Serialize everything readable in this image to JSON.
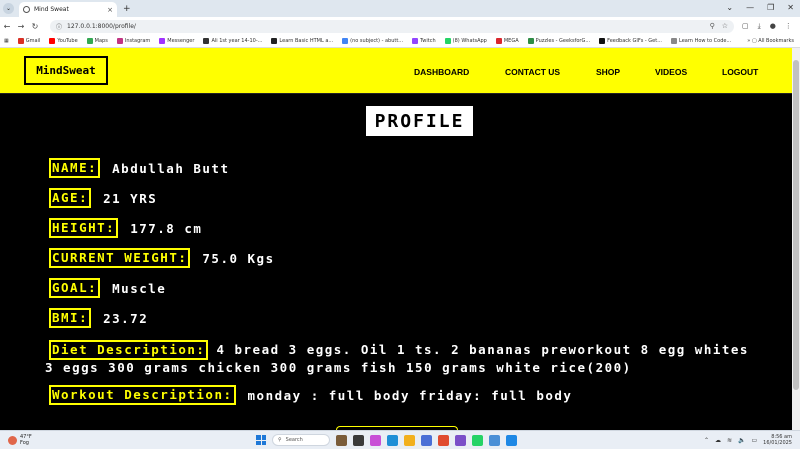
{
  "browser": {
    "tab_title": "Mind Sweat",
    "tab_close": "×",
    "new_tab": "+",
    "url": "127.0.0.1:8000/profile/",
    "window_controls": [
      "⌄",
      "—",
      "❐",
      "✕"
    ],
    "bookmarks": [
      {
        "label": "Gmail",
        "color": "#d93025"
      },
      {
        "label": "YouTube",
        "color": "#ff0000"
      },
      {
        "label": "Maps",
        "color": "#34a853"
      },
      {
        "label": "Instagram",
        "color": "#c13584"
      },
      {
        "label": "Messenger",
        "color": "#a033ff"
      },
      {
        "label": "Ali 1st year 14-10-...",
        "color": "#333333"
      },
      {
        "label": "Learn Basic HTML a...",
        "color": "#222222"
      },
      {
        "label": "(no subject) - abutt...",
        "color": "#4285f4"
      },
      {
        "label": "Twitch",
        "color": "#9146ff"
      },
      {
        "label": "(8) WhatsApp",
        "color": "#25d366"
      },
      {
        "label": "MEGA",
        "color": "#d9272e"
      },
      {
        "label": "Puzzles - GeeksforG...",
        "color": "#2f8d46"
      },
      {
        "label": "Feedback GIFs - Get...",
        "color": "#111111"
      },
      {
        "label": "Learn How to Code...",
        "color": "#888888"
      }
    ],
    "all_bookmarks": "All Bookmarks"
  },
  "site": {
    "logo": "MindSweat",
    "nav": [
      "DASHBOARD",
      "CONTACT US",
      "SHOP",
      "VIDEOS",
      "LOGOUT"
    ],
    "accent": "#ffff00"
  },
  "profile": {
    "title": "PROFILE",
    "fields": [
      {
        "label": "NAME:",
        "value": "Abdullah Butt"
      },
      {
        "label": "AGE:",
        "value": "21 YRS"
      },
      {
        "label": "HEIGHT:",
        "value": "177.8 cm"
      },
      {
        "label": "CURRENT WEIGHT:",
        "value": "75.0 Kgs"
      },
      {
        "label": "GOAL:",
        "value": "Muscle"
      },
      {
        "label": "BMI:",
        "value": "23.72"
      }
    ],
    "diet": {
      "label": "Diet Description:",
      "value": "4 bread 3 eggs. Oil 1 ts. 2 bananas preworkout 8 egg whites 3 eggs 300 grams chicken 300 grams fish 150 grams white rice(200)"
    },
    "workout": {
      "label": "Workout Description:",
      "value": "monday : full body friday: full body"
    }
  },
  "taskbar": {
    "weather_temp": "47°F",
    "weather_desc": "Fog",
    "search": "Search",
    "time": "8:56 am",
    "date": "16/01/2025"
  }
}
